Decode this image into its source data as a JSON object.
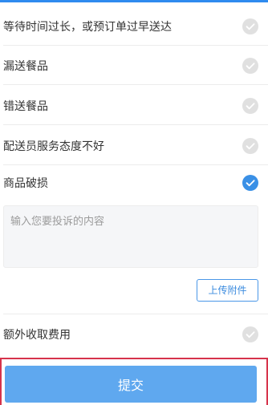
{
  "options": [
    {
      "label": "等待时间过长，或预订单过早送达",
      "checked": false
    },
    {
      "label": "漏送餐品",
      "checked": false
    },
    {
      "label": "错送餐品",
      "checked": false
    },
    {
      "label": "配送员服务态度不好",
      "checked": false
    },
    {
      "label": "商品破损",
      "checked": true
    }
  ],
  "complaint": {
    "placeholder": "输入您要投诉的内容",
    "value": ""
  },
  "upload": {
    "label": "上传附件"
  },
  "extra_option": {
    "label": "额外收取费用",
    "checked": false
  },
  "submit": {
    "label": "提交"
  },
  "colors": {
    "accent": "#2f8bef",
    "check_on": "#3a90e6",
    "check_off": "#e0e0e0",
    "submit_bg": "#5fa8ef",
    "highlight": "#d6334b"
  }
}
